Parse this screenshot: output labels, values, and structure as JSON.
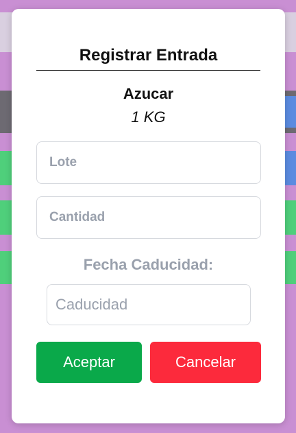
{
  "dialog": {
    "title": "Registrar Entrada",
    "product_name": "Azucar",
    "product_unit": "1 KG",
    "lote_placeholder": "Lote",
    "cantidad_placeholder": "Cantidad",
    "fecha_label": "Fecha Caducidad:",
    "caducidad_placeholder": "Caducidad",
    "accept_label": "Aceptar",
    "cancel_label": "Cancelar"
  },
  "colors": {
    "accept": "#0aa94a",
    "cancel": "#fc2a3c",
    "backdrop": "#c98fd3",
    "muted_text": "#9aa1ad"
  }
}
